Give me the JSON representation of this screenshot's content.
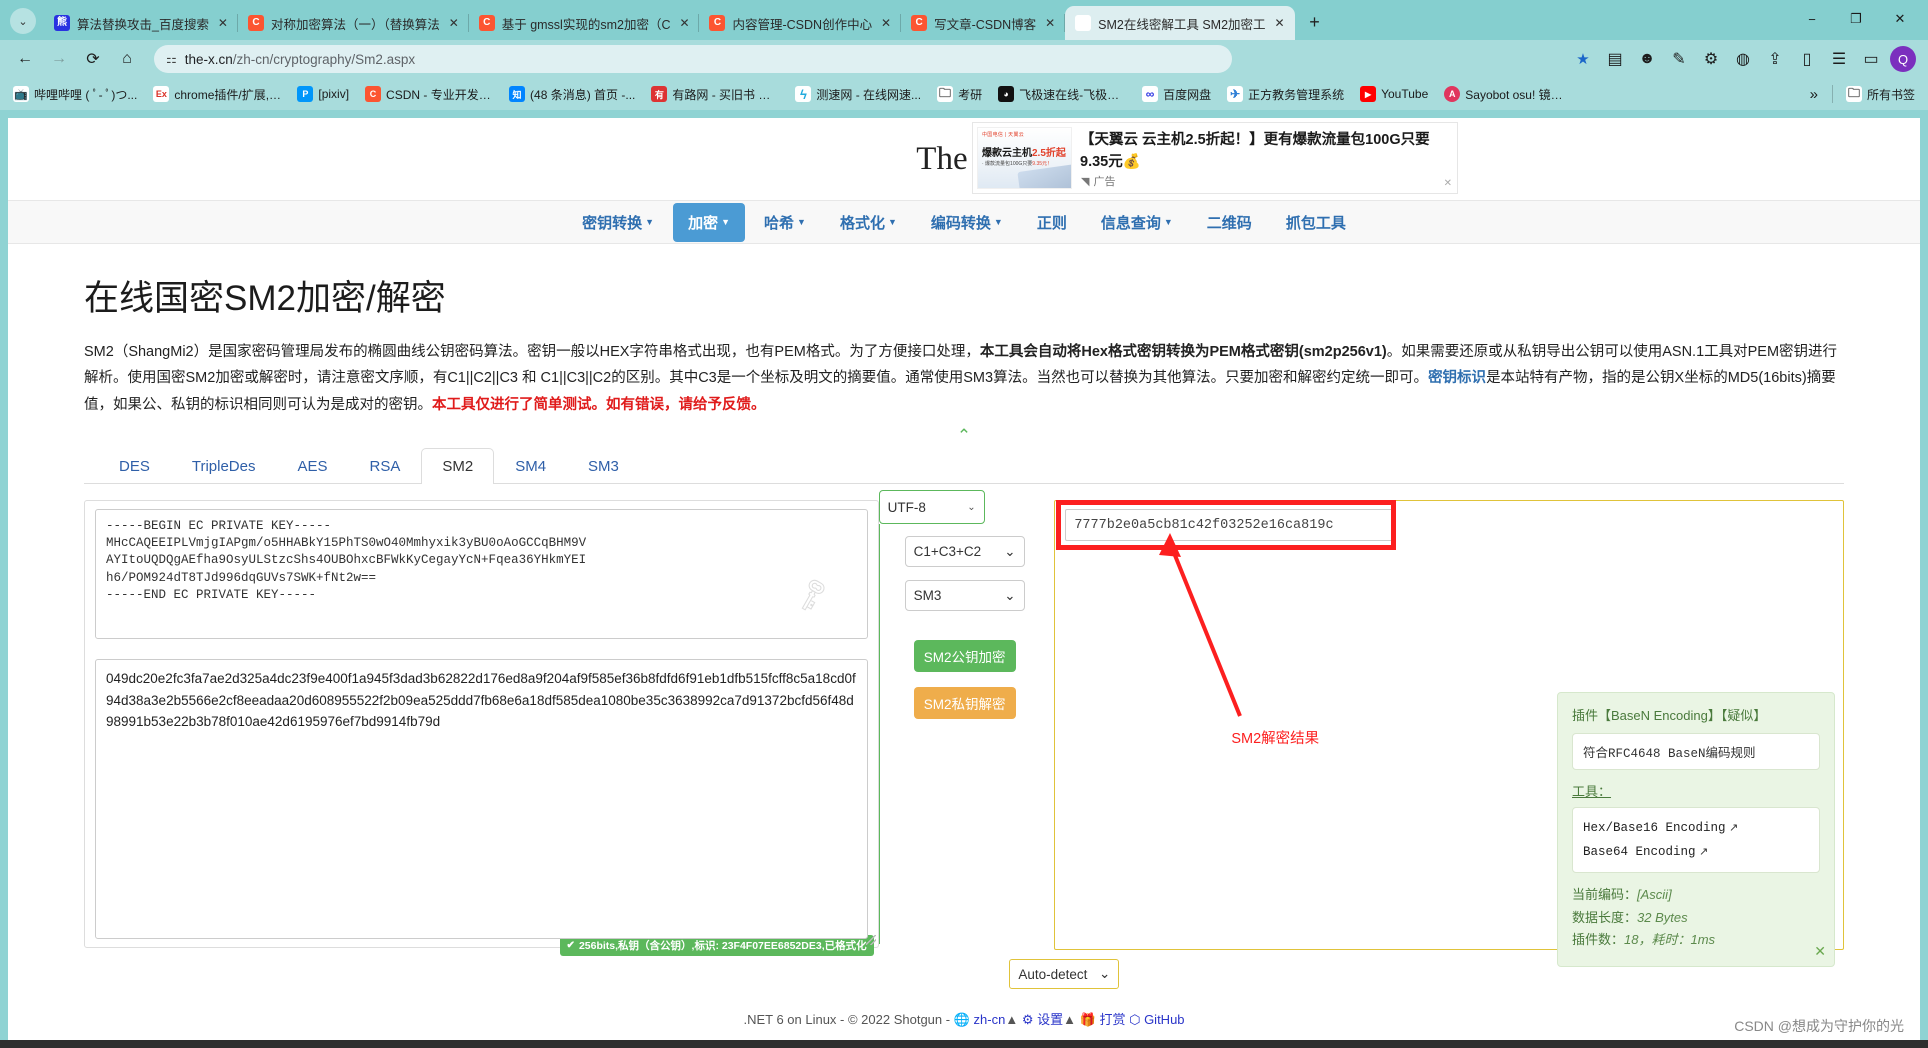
{
  "browser": {
    "tabs": [
      {
        "title": "算法替换攻击_百度搜索",
        "favicon": "baidu-icon",
        "active": false
      },
      {
        "title": "对称加密算法（一）（替换算法",
        "favicon": "csdn-icon",
        "active": false
      },
      {
        "title": "基于 gmssl实现的sm2加密（C",
        "favicon": "csdn-icon",
        "active": false
      },
      {
        "title": "内容管理-CSDN创作中心",
        "favicon": "csdn-icon",
        "active": false
      },
      {
        "title": "写文章-CSDN博客",
        "favicon": "csdn-icon",
        "active": false
      },
      {
        "title": "SM2在线密解工具 SM2加密工",
        "favicon": "tool-icon",
        "active": true
      }
    ],
    "tab_close_label": "✕",
    "new_tab_label": "+",
    "window_controls": [
      "−",
      "❐",
      "✕"
    ],
    "nav": {
      "back": "←",
      "forward": "→",
      "reload": "⟳",
      "home": "⌂"
    },
    "omnibox": {
      "site_info_icon": "tune-icon",
      "host": "the-x.cn",
      "path": "/zh-cn/cryptography/Sm2.aspx"
    },
    "toolbar_right_icons": [
      "star-icon",
      "split-screen-icon",
      "face-icon",
      "pen-icon",
      "puzzle-icon",
      "globe-icon",
      "share-icon",
      "tabs-icon",
      "list-icon",
      "sidebar-icon",
      "profile-icon"
    ],
    "bookmarks": [
      {
        "label": "哔哩哔哩 ( ﾟ- ﾟ)つ...",
        "icon": "bili-icon"
      },
      {
        "label": "chrome插件/扩展,c...",
        "icon": "ex-icon"
      },
      {
        "label": "[pixiv]",
        "icon": "pixiv-icon"
      },
      {
        "label": "CSDN - 专业开发者...",
        "icon": "csdn-icon"
      },
      {
        "label": "(48 条消息) 首页 -...",
        "icon": "zhihu-icon"
      },
      {
        "label": "有路网 - 买旧书 上...",
        "icon": "youlu-icon"
      },
      {
        "label": "测速网 - 在线网速...",
        "icon": "speed-icon"
      },
      {
        "label": "考研",
        "icon": "folder-icon"
      },
      {
        "label": "飞极速在线-飞极速...",
        "icon": "fly-icon"
      },
      {
        "label": "百度网盘",
        "icon": "baiduyun-icon"
      },
      {
        "label": "正方教务管理系统",
        "icon": "zf-icon"
      },
      {
        "label": "YouTube",
        "icon": "youtube-icon"
      },
      {
        "label": "Sayobot osu! 镜像...",
        "icon": "sayobot-icon"
      }
    ],
    "bookmarks_overflow": "»",
    "all_bookmarks": "所有书签"
  },
  "site": {
    "brand_text": "The",
    "brand_icon": "wrench-icon"
  },
  "ad": {
    "headline": "【天翼云 云主机2.5折起！】更有爆款流量包100G只要9.35元",
    "emoji": "💰",
    "thumb_brand": "中国电信 | 天翼云",
    "thumb_headline_a": "爆款云主机",
    "thumb_headline_b": "2.5折起",
    "thumb_sub_a": "· 爆款流量包100G只要",
    "thumb_sub_b": "9.35元！",
    "label": "广告",
    "label_icon": "triangle-icon",
    "close": "✕"
  },
  "nav_menu": [
    {
      "label": "密钥转换",
      "caret": true,
      "active": false
    },
    {
      "label": "加密",
      "caret": true,
      "active": true
    },
    {
      "label": "哈希",
      "caret": true,
      "active": false
    },
    {
      "label": "格式化",
      "caret": true,
      "active": false
    },
    {
      "label": "编码转换",
      "caret": true,
      "active": false
    },
    {
      "label": "正则",
      "caret": false,
      "active": false
    },
    {
      "label": "信息查询",
      "caret": true,
      "active": false
    },
    {
      "label": "二维码",
      "caret": false,
      "active": false
    },
    {
      "label": "抓包工具",
      "caret": false,
      "active": false
    }
  ],
  "main": {
    "title": "在线国密SM2加密/解密",
    "desc_line1_a": "SM2（ShangMi2）是国家密码管理局发布的椭圆曲线公钥密码算法。密钥一般以HEX字符串格式出现，也有PEM格式。为了方便接口处理，",
    "desc_line1_bold": "本工具会自动将Hex格式密钥转换为PEM格式密钥(sm2p256v1)",
    "desc_line1_b": "。如果需要还原或从私钥导出公钥可以使用ASN.1工具对PEM密钥进行解析。使用",
    "desc_line2_a": "国密SM2加密或解密时，请注意密文序顺，有C1||C2||C3 和 C1||C3||C2的区别。其中C3是一个坐标及明文的摘要值。通常使用SM3算法。当然也可以替换为其他算法。只要加密和解密约定统一即可。",
    "desc_line2_link": "密钥标识",
    "desc_line2_b": "是本站特有产物，指的是公钥X坐标的MD5(16bits)摘要值，如果公、私钥的标",
    "desc_line3_a": "识相同则可认为是成对的密钥。",
    "desc_line3_red": "本工具仅进行了简单测试。如有错误，请给予反馈。",
    "collapse_caret": "⌃",
    "tabs": [
      {
        "label": "DES",
        "active": false
      },
      {
        "label": "TripleDes",
        "active": false
      },
      {
        "label": "AES",
        "active": false
      },
      {
        "label": "RSA",
        "active": false
      },
      {
        "label": "SM2",
        "active": true
      },
      {
        "label": "SM4",
        "active": false
      },
      {
        "label": "SM3",
        "active": false
      }
    ],
    "private_key": "-----BEGIN EC PRIVATE KEY-----\nMHcCAQEEIPLVmjgIAPgm/o5HHABkY15PhTS0wO40Mmhyxik3yBU0oAoGCCqBHM9V\nAYItoUQDQgAEfha9OsyULStzcShs4OUBOhxcBFWkKyCegayYcN+Fqea36YHkmYEI\nh6/POM924dT8TJd996dqGUVs7SWK+fNt2w==\n-----END EC PRIVATE KEY-----",
    "key_watermark_icon": "key-icon",
    "key_badge": "256bits,私钥（含公钥）,标识: 23F4F07EE6852DE3,已格式化",
    "key_badge_icon": "check-circle-icon",
    "ciphertext": "049dc20e2fc3fa7ae2d325a4dc23f9e400f1a945f3dad3b62822d176ed8a9f204af9f585ef36b8fdfd6f91eb1dfb515fcff8c5a18cd0f94d38a3e2b5566e2cf8eeadaa20d608955522f2b09ea525ddd7fb68e6a18df585dea1080be35c3638992ca7d91372bcfd56f48d98991b53e22b3b78f010ae42d6195976ef7bd9914fb79d",
    "encoding_select": "UTF-8",
    "cipher_order_select": "C1+C3+C2",
    "hash_select": "SM3",
    "encrypt_button": "SM2公钥加密",
    "decrypt_button": "SM2私钥解密",
    "result_value": "7777b2e0a5cb81c42f03252e16ca819c",
    "annotation": "SM2解密结果",
    "autodetect_select": "Auto-detect"
  },
  "plugin": {
    "title": "插件【BaseN Encoding】【疑似】",
    "rule": "符合RFC4648 BaseN编码规则",
    "tools_label": "工具：",
    "tools": [
      {
        "label": "Hex/Base16 Encoding",
        "icon": "external-link-icon"
      },
      {
        "label": "Base64 Encoding",
        "icon": "external-link-icon"
      }
    ],
    "meta": [
      {
        "key": "当前编码：",
        "value": "[Ascii]"
      },
      {
        "key": "数据长度：",
        "value": "32 Bytes"
      },
      {
        "key": "插件数：",
        "value": "18，耗时：1ms"
      }
    ],
    "close": "✕"
  },
  "footer": {
    "text": ".NET 6 on Linux - © 2022 Shotgun -",
    "lang": "zh-cn",
    "lang_icon": "globe-icon",
    "lang_caret": "▲",
    "settings": "设置",
    "settings_icon": "gear-icon",
    "settings_caret": "▲",
    "donate": "打赏",
    "donate_icon": "gift-icon",
    "github": "GitHub",
    "github_icon": "github-icon"
  },
  "watermark": "CSDN @想成为守护你的光",
  "colors": {
    "accent_blue": "#4b9bd4",
    "green": "#5cb85c",
    "orange": "#efad4b",
    "red": "#fc1f1f",
    "yellow_border": "#e0c33a",
    "chrome_bg": "#8fd3d3"
  }
}
